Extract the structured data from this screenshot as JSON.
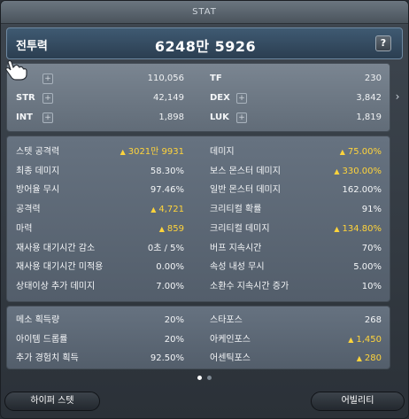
{
  "window": {
    "title": "STAT"
  },
  "combat_power": {
    "label": "전투력",
    "value": "6248만 5926",
    "help_label": "?"
  },
  "basic_stats": {
    "left": [
      {
        "name": "",
        "plus": "+",
        "value": "110,056"
      },
      {
        "name": "STR",
        "plus": "+",
        "value": "42,149"
      },
      {
        "name": "INT",
        "plus": "+",
        "value": "1,898"
      }
    ],
    "right": [
      {
        "name": "TF",
        "value": "230"
      },
      {
        "name": "DEX",
        "plus": "+",
        "value": "3,842"
      },
      {
        "name": "LUK",
        "plus": "+",
        "value": "1,819"
      }
    ],
    "arrow": "›"
  },
  "detail_stats": {
    "left": [
      {
        "name": "스텟 공격력",
        "value": "3021만 9931",
        "up": true
      },
      {
        "name": "최종 데미지",
        "value": "58.30%",
        "up": false
      },
      {
        "name": "방어율 무시",
        "value": "97.46%",
        "up": false
      },
      {
        "name": "공격력",
        "value": "4,721",
        "up": true
      },
      {
        "name": "마력",
        "value": "859",
        "up": true
      },
      {
        "name": "재사용 대기시간 감소",
        "value": "0초 / 5%",
        "up": false
      },
      {
        "name": "재사용 대기시간 미적용",
        "value": "0.00%",
        "up": false
      },
      {
        "name": "상태이상 추가 데미지",
        "value": "7.00%",
        "up": false
      }
    ],
    "right": [
      {
        "name": "데미지",
        "value": "75.00%",
        "up": true
      },
      {
        "name": "보스 몬스터 데미지",
        "value": "330.00%",
        "up": true
      },
      {
        "name": "일반 몬스터 데미지",
        "value": "162.00%",
        "up": false
      },
      {
        "name": "크리티컬 확률",
        "value": "91%",
        "up": false
      },
      {
        "name": "크리티컬 데미지",
        "value": "134.80%",
        "up": true
      },
      {
        "name": "버프 지속시간",
        "value": "70%",
        "up": false
      },
      {
        "name": "속성 내성 무시",
        "value": "5.00%",
        "up": false
      },
      {
        "name": "소환수 지속시간 증가",
        "value": "10%",
        "up": false
      }
    ]
  },
  "extra_stats": {
    "left": [
      {
        "name": "메소 획득량",
        "value": "20%",
        "up": false
      },
      {
        "name": "아이템 드롭률",
        "value": "20%",
        "up": false
      },
      {
        "name": "추가 경험치 획득",
        "value": "92.50%",
        "up": false
      }
    ],
    "right": [
      {
        "name": "스타포스",
        "value": "268",
        "up": false
      },
      {
        "name": "아케인포스",
        "value": "1,450",
        "up": true
      },
      {
        "name": "어센틱포스",
        "value": "280",
        "up": true
      }
    ]
  },
  "pager": {
    "pages": 2,
    "active": 0
  },
  "buttons": {
    "hyper_stat": "하이퍼 스텟",
    "ability": "어빌리티"
  },
  "colors": {
    "highlight": "#ffd43b",
    "up_arrow": "#ffd43b"
  },
  "up_arrow_glyph": "▲"
}
